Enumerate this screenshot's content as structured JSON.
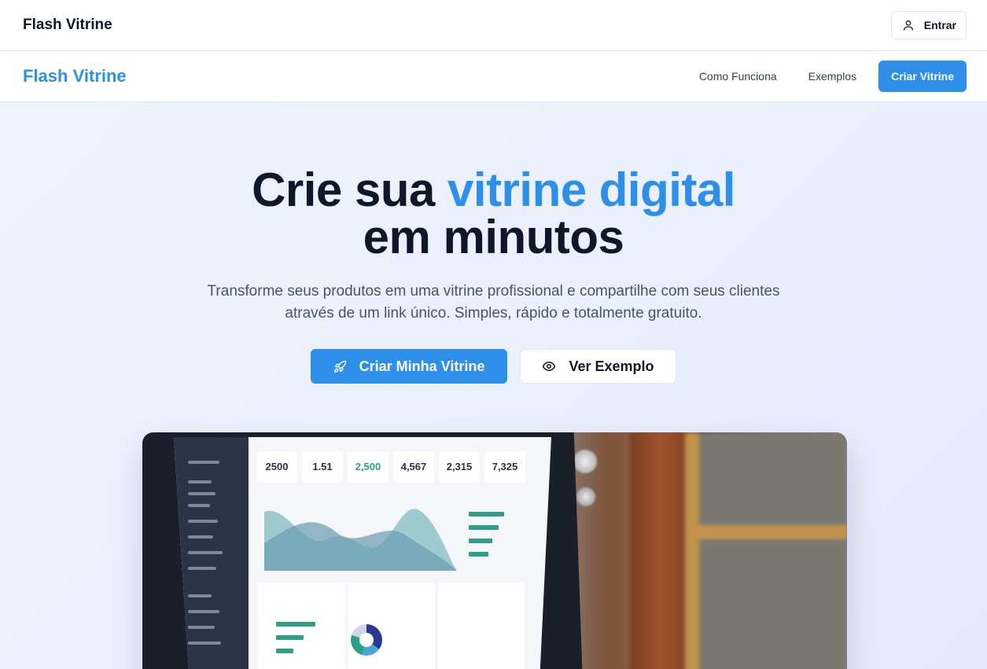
{
  "topbar": {
    "brand": "Flash Vitrine",
    "login_label": "Entrar",
    "login_icon": "user-icon"
  },
  "navbar": {
    "brand": "Flash Vitrine",
    "links": [
      "Como Funciona",
      "Exemplos"
    ],
    "cta_label": "Criar Vitrine"
  },
  "hero": {
    "title_part1": "Crie sua ",
    "title_accent": "vitrine digital",
    "title_part2": "em minutos",
    "subtitle_line1": "Transforme seus produtos em uma vitrine profissional e compartilhe com seus clientes",
    "subtitle_line2": "através de um link único. Simples, rápido e totalmente gratuito.",
    "primary_cta": "Criar Minha Vitrine",
    "primary_icon": "rocket-icon",
    "secondary_cta": "Ver Exemplo",
    "secondary_icon": "eye-icon",
    "image_stats": [
      "2500",
      "1.51",
      "2,500",
      "4,567",
      "2,315",
      "7,325"
    ]
  },
  "colors": {
    "accent": "#2d8fe8",
    "text_dark": "#0f172a",
    "text_muted": "#475569"
  }
}
